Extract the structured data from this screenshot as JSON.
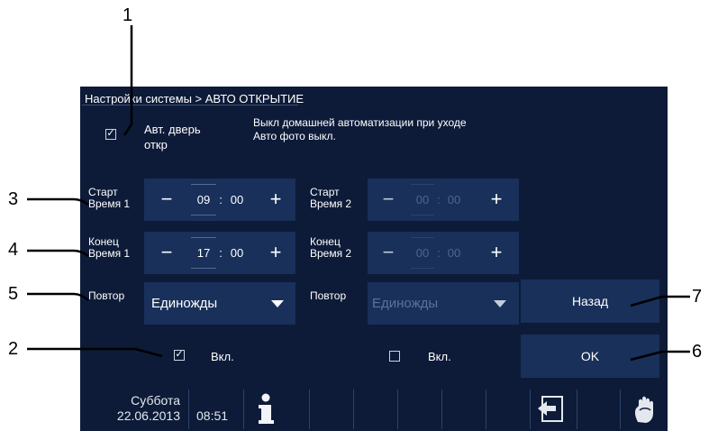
{
  "callouts": {
    "c1": "1",
    "c2": "2",
    "c3": "3",
    "c4": "4",
    "c5": "5",
    "c6": "6",
    "c7": "7"
  },
  "header": {
    "breadcrumb": "Настройки системы > АВТО ОТКРЫТИЕ"
  },
  "auto_door": {
    "label_line1": "Авт. дверь",
    "label_line2": "откр",
    "checked": true
  },
  "info": {
    "line1": "Выкл домашней автоматизации при уходе",
    "line2": "Авто фото выкл."
  },
  "schedule1": {
    "start_label1": "Старт",
    "start_label2": "Время 1",
    "start_hour": "09",
    "start_min": "00",
    "end_label1": "Конец",
    "end_label2": "Время 1",
    "end_hour": "17",
    "end_min": "00",
    "repeat_label": "Повтор",
    "repeat_value": "Единожды",
    "enable_label": "Вкл.",
    "enabled": true
  },
  "schedule2": {
    "start_label1": "Старт",
    "start_label2": "Время 2",
    "start_hour": "00",
    "start_min": "00",
    "end_label1": "Конец",
    "end_label2": "Время 2",
    "end_hour": "00",
    "end_min": "00",
    "repeat_label": "Повтор",
    "repeat_value": "Единожды",
    "enable_label": "Вкл.",
    "enabled": false
  },
  "symbols": {
    "minus": "−",
    "plus": "+",
    "colon": ":",
    "check": "✓"
  },
  "buttons": {
    "back": "Назад",
    "ok": "OK"
  },
  "status": {
    "day": "Суббота",
    "date": "22.06.2013",
    "time": "08:51"
  },
  "icons": [
    "info-icon",
    "back-to-screen-icon",
    "hand-touch-icon"
  ],
  "colors": {
    "screen_bg": "#0d1b38",
    "panel_bg": "#18305a",
    "text": "#ffffff",
    "dim_text": "#4d6590"
  }
}
